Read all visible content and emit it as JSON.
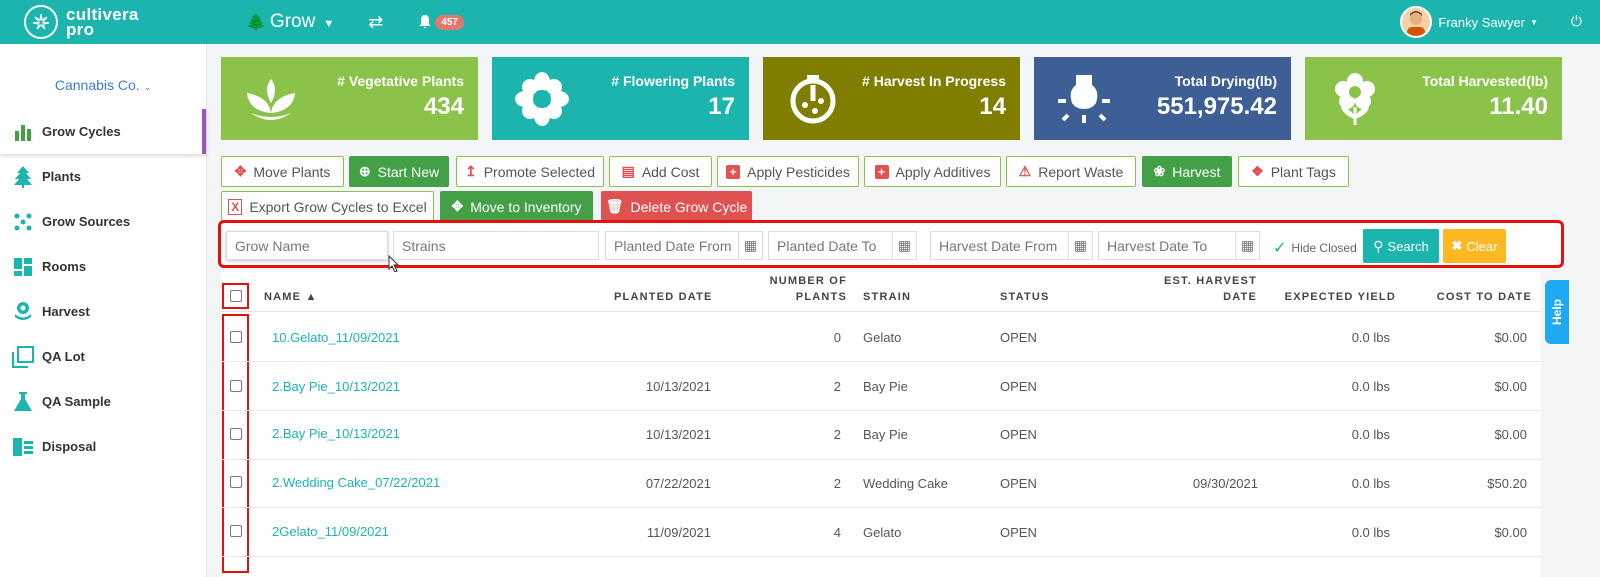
{
  "brand": {
    "name_line1": "cultivera",
    "name_line2": "pro"
  },
  "header": {
    "module": "Grow",
    "notifications_count": "457",
    "user_name": "Franky Sawyer"
  },
  "sidebar": {
    "company": "Cannabis Co.",
    "items": [
      {
        "label": "Grow Cycles",
        "icon": "bar-chart-icon"
      },
      {
        "label": "Plants",
        "icon": "tree-icon"
      },
      {
        "label": "Grow Sources",
        "icon": "dots-icon"
      },
      {
        "label": "Rooms",
        "icon": "grid-icon"
      },
      {
        "label": "Harvest",
        "icon": "harvest-icon"
      },
      {
        "label": "QA Lot",
        "icon": "copy-icon"
      },
      {
        "label": "QA Sample",
        "icon": "flask-icon"
      },
      {
        "label": "Disposal",
        "icon": "trash-icon"
      }
    ]
  },
  "stats": [
    {
      "label": "# Vegetative Plants",
      "value": "434",
      "color": "#8bc34a",
      "icon": "sprout-icon"
    },
    {
      "label": "# Flowering Plants",
      "value": "17",
      "color": "#1bb5ad",
      "icon": "flower-icon"
    },
    {
      "label": "# Harvest In Progress",
      "value": "14",
      "color": "#807e00",
      "icon": "timer-icon"
    },
    {
      "label": "Total Drying(lb)",
      "value": "551,975.42",
      "color": "#3d5f95",
      "icon": "lightbulb-icon"
    },
    {
      "label": "Total Harvested(lb)",
      "value": "11.40",
      "color": "#8bc34a",
      "icon": "blossom-icon"
    }
  ],
  "actions": {
    "move_plants": "Move Plants",
    "start_new": "Start New",
    "promote_selected": "Promote Selected",
    "add_cost": "Add Cost",
    "apply_pesticides": "Apply Pesticides",
    "apply_additives": "Apply Additives",
    "report_waste": "Report Waste",
    "harvest": "Harvest",
    "plant_tags": "Plant Tags",
    "export_excel": "Export Grow Cycles to Excel",
    "move_inventory": "Move to Inventory",
    "delete_cycle": "Delete Grow Cycle"
  },
  "filters": {
    "grow_name": "Grow Name",
    "strains": "Strains",
    "planted_from": "Planted Date From",
    "planted_to": "Planted Date To",
    "harvest_from": "Harvest Date From",
    "harvest_to": "Harvest Date To",
    "hide_closed": "Hide Closed",
    "search": "Search",
    "clear": "Clear"
  },
  "table": {
    "headers": {
      "name": "NAME ▲",
      "planted_date": "PLANTED DATE",
      "num_plants_1": "NUMBER OF",
      "num_plants_2": "PLANTS",
      "strain": "STRAIN",
      "status": "STATUS",
      "est_harvest_1": "EST. HARVEST",
      "est_harvest_2": "DATE",
      "expected_yield": "EXPECTED YIELD",
      "cost": "COST TO DATE"
    },
    "rows": [
      {
        "name": "10.Gelato_11/09/2021",
        "planted": "",
        "plants": "0",
        "strain": "Gelato",
        "status": "OPEN",
        "est_harvest": "",
        "yield": "0.0 lbs",
        "cost": "$0.00"
      },
      {
        "name": "2.Bay Pie_10/13/2021",
        "planted": "10/13/2021",
        "plants": "2",
        "strain": "Bay Pie",
        "status": "OPEN",
        "est_harvest": "",
        "yield": "0.0 lbs",
        "cost": "$0.00"
      },
      {
        "name": "2.Bay Pie_10/13/2021",
        "planted": "10/13/2021",
        "plants": "2",
        "strain": "Bay Pie",
        "status": "OPEN",
        "est_harvest": "",
        "yield": "0.0 lbs",
        "cost": "$0.00"
      },
      {
        "name": "2.Wedding Cake_07/22/2021",
        "planted": "07/22/2021",
        "plants": "2",
        "strain": "Wedding Cake",
        "status": "OPEN",
        "est_harvest": "09/30/2021",
        "yield": "0.0 lbs",
        "cost": "$50.20"
      },
      {
        "name": "2Gelato_11/09/2021",
        "planted": "11/09/2021",
        "plants": "4",
        "strain": "Gelato",
        "status": "OPEN",
        "est_harvest": "",
        "yield": "0.0 lbs",
        "cost": "$0.00"
      }
    ]
  },
  "help": "Help"
}
